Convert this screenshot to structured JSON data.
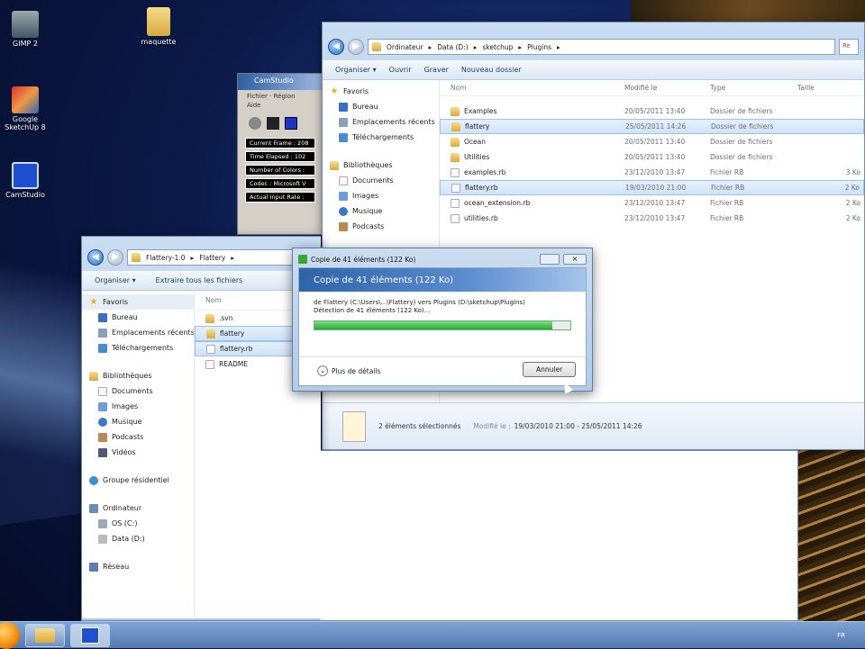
{
  "desktop": {
    "icons": [
      {
        "label": "GIMP 2"
      },
      {
        "label": "maquette"
      },
      {
        "label": "Google SketchUp 8"
      },
      {
        "label": "CamStudio"
      }
    ]
  },
  "camstudio": {
    "title": "CamStudio",
    "menu": [
      "Fichier",
      "Région",
      "Aide"
    ],
    "fields": [
      "Current Frame : 208",
      "Time Elapsed : 102",
      "Number of Colors :",
      "Codec : Microsoft V",
      "Actual Input Rate :"
    ]
  },
  "back_window": {
    "path": [
      "Ordinateur",
      "Data (D:)",
      "sketchup",
      "Plugins"
    ],
    "toolbar": [
      "Organiser ▾",
      "Ouvrir",
      "Graver",
      "Nouveau dossier"
    ],
    "nav": {
      "favorites": "Favoris",
      "fav_items": [
        "Bureau",
        "Emplacements récents",
        "Téléchargements"
      ],
      "libraries": "Bibliothèques",
      "lib_items": [
        "Documents",
        "Images",
        "Musique",
        "Podcasts"
      ]
    },
    "columns": [
      "Nom",
      "Modifié le",
      "Type",
      "Taille"
    ],
    "rows": [
      {
        "name": "Examples",
        "date": "20/05/2011 13:40",
        "type": "Dossier de fichiers",
        "size": ""
      },
      {
        "name": "flattery",
        "date": "25/05/2011 14:26",
        "type": "Dossier de fichiers",
        "size": ""
      },
      {
        "name": "Ocean",
        "date": "20/05/2011 13:40",
        "type": "Dossier de fichiers",
        "size": ""
      },
      {
        "name": "Utilities",
        "date": "20/05/2011 13:40",
        "type": "Dossier de fichiers",
        "size": ""
      },
      {
        "name": "examples.rb",
        "date": "23/12/2010 13:47",
        "type": "Fichier RB",
        "size": "3 Ko"
      },
      {
        "name": "flattery.rb",
        "date": "19/03/2010 21:00",
        "type": "Fichier RB",
        "size": "2 Ko"
      },
      {
        "name": "ocean_extension.rb",
        "date": "23/12/2010 13:47",
        "type": "Fichier RB",
        "size": "2 Ko"
      },
      {
        "name": "utilities.rb",
        "date": "23/12/2010 13:47",
        "type": "Fichier RB",
        "size": "2 Ko"
      }
    ],
    "status": {
      "count": "2 éléments sélectionnés",
      "modified_label": "Modifié le :",
      "modified_value": "19/03/2010 21:00 - 25/05/2011 14:26"
    }
  },
  "front_window": {
    "path": [
      "Flattery-1.0",
      "Flattery"
    ],
    "toolbar": [
      "Organiser ▾",
      "Extraire tous les fichiers"
    ],
    "nav": {
      "favorites": "Favoris",
      "fav_items": [
        "Bureau",
        "Emplacements récents",
        "Téléchargements"
      ],
      "libraries": "Bibliothèques",
      "lib_items": [
        "Documents",
        "Images",
        "Musique",
        "Podcasts",
        "Vidéos"
      ],
      "homegroup": "Groupe résidentiel",
      "computer": "Ordinateur",
      "drives": [
        "OS (C:)",
        "Data (D:)"
      ],
      "network": "Réseau"
    },
    "column": "Nom",
    "rows": [
      ".svn",
      "flattery",
      "flattery.rb",
      "README"
    ]
  },
  "dialog": {
    "title": "Copie de 41 éléments (122 Ko)",
    "heading": "Copie de 41 éléments (122 Ko)",
    "line1": "de Flattery (C:\\Users\\...\\Flattery) vers Plugins (D:\\sketchup\\Plugins)",
    "line2": "Détection de 41 éléments (122 Ko)...",
    "progress": 0.93,
    "details": "Plus de détails",
    "cancel": "Annuler"
  },
  "taskbar": {
    "lang": "FR"
  }
}
